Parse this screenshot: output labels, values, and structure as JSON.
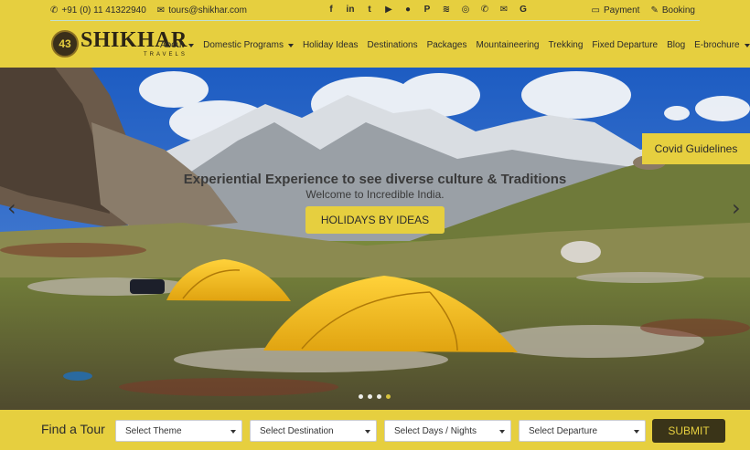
{
  "topbar": {
    "phone": "+91 (0) 11 41322940",
    "email": "tours@shikhar.com",
    "socials": [
      {
        "name": "facebook",
        "glyph": "f"
      },
      {
        "name": "linkedin",
        "glyph": "in"
      },
      {
        "name": "twitter",
        "glyph": "t"
      },
      {
        "name": "youtube",
        "glyph": "▶"
      },
      {
        "name": "flickr",
        "glyph": "●"
      },
      {
        "name": "pinterest",
        "glyph": "P"
      },
      {
        "name": "rss",
        "glyph": "≋"
      },
      {
        "name": "instagram",
        "glyph": "◎"
      },
      {
        "name": "whatsapp",
        "glyph": "✆"
      },
      {
        "name": "mail",
        "glyph": "✉"
      },
      {
        "name": "google",
        "glyph": "G"
      }
    ],
    "payment": "Payment",
    "booking": "Booking"
  },
  "logo": {
    "badge": "43",
    "brand": "SHIKHAR",
    "sub": "TRAVELS"
  },
  "nav": [
    {
      "label": "About",
      "dropdown": true
    },
    {
      "label": "Domestic Programs",
      "dropdown": true
    },
    {
      "label": "Holiday Ideas",
      "dropdown": false
    },
    {
      "label": "Destinations",
      "dropdown": false
    },
    {
      "label": "Packages",
      "dropdown": false
    },
    {
      "label": "Mountaineering",
      "dropdown": false
    },
    {
      "label": "Trekking",
      "dropdown": false
    },
    {
      "label": "Fixed Departure",
      "dropdown": false
    },
    {
      "label": "Blog",
      "dropdown": false
    },
    {
      "label": "E-brochure",
      "dropdown": true
    }
  ],
  "hero": {
    "covid": "Covid Guidelines",
    "title": "Experiential Experience to see diverse culture & Traditions",
    "subtitle": "Welcome to Incredible India.",
    "cta": "HOLIDAYS BY IDEAS",
    "slides": 4,
    "active_slide": 4
  },
  "find": {
    "label": "Find a Tour",
    "theme": "Select Theme",
    "destination": "Select Destination",
    "days": "Select Days / Nights",
    "departure": "Select Departure",
    "submit": "SUBMIT"
  },
  "colors": {
    "accent": "#e6cf3f",
    "dark": "#3a3418"
  }
}
